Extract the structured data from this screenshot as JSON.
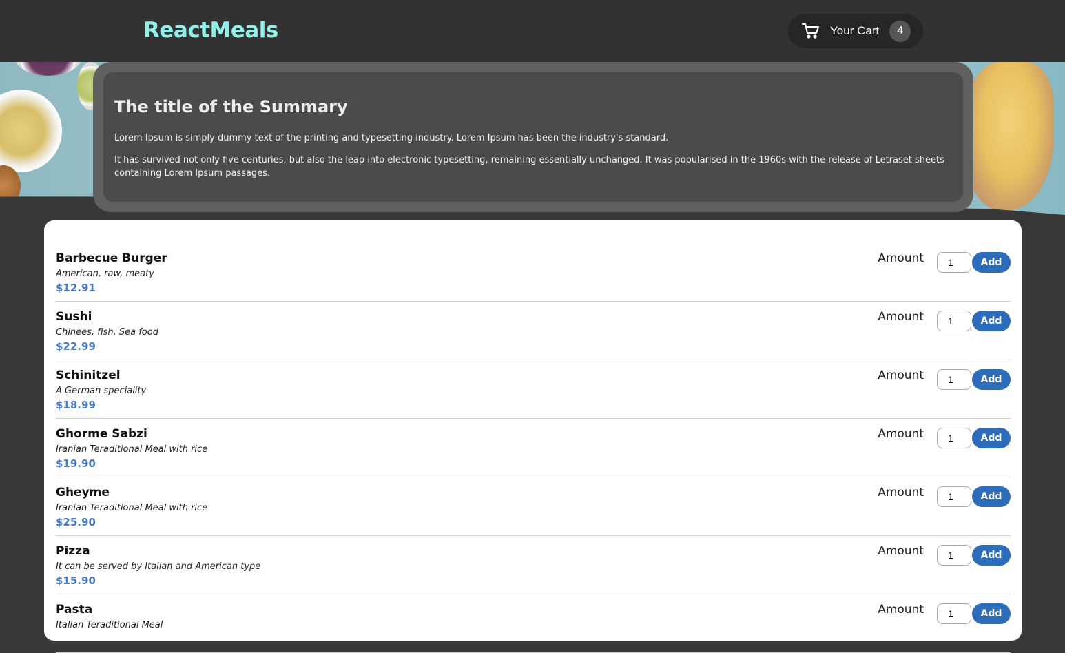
{
  "header": {
    "logo": "ReactMeals",
    "cart": {
      "label": "Your Cart",
      "count": "4"
    }
  },
  "summary": {
    "title": "The title of the Summary",
    "paragraphs": [
      "Lorem Ipsum is simply dummy text of the printing and typesetting industry. Lorem Ipsum has been the industry's standard.",
      "It has survived not only five centuries, but also the leap into electronic typesetting, remaining essentially unchanged. It was popularised in the 1960s with the release of Letraset sheets containing Lorem Ipsum passages."
    ]
  },
  "meals": [
    {
      "name": "Barbecue Burger",
      "description": "American, raw, meaty",
      "price": "$12.91",
      "amount_label": "Amount",
      "amount": "1",
      "add_label": "Add"
    },
    {
      "name": "Sushi",
      "description": "Chinees, fish, Sea food",
      "price": "$22.99",
      "amount_label": "Amount",
      "amount": "1",
      "add_label": "Add"
    },
    {
      "name": "Schinitzel",
      "description": "A German speciality",
      "price": "$18.99",
      "amount_label": "Amount",
      "amount": "1",
      "add_label": "Add"
    },
    {
      "name": "Ghorme Sabzi",
      "description": "Iranian Teraditional Meal with rice",
      "price": "$19.90",
      "amount_label": "Amount",
      "amount": "1",
      "add_label": "Add"
    },
    {
      "name": "Gheyme",
      "description": "Iranian Teraditional Meal with rice",
      "price": "$25.90",
      "amount_label": "Amount",
      "amount": "1",
      "add_label": "Add"
    },
    {
      "name": "Pizza",
      "description": "It can be served by Italian and American type",
      "price": "$15.90",
      "amount_label": "Amount",
      "amount": "1",
      "add_label": "Add"
    },
    {
      "name": "Pasta",
      "description": "Italian Teraditional Meal",
      "price": "",
      "amount_label": "Amount",
      "amount": "1",
      "add_label": "Add"
    }
  ]
}
